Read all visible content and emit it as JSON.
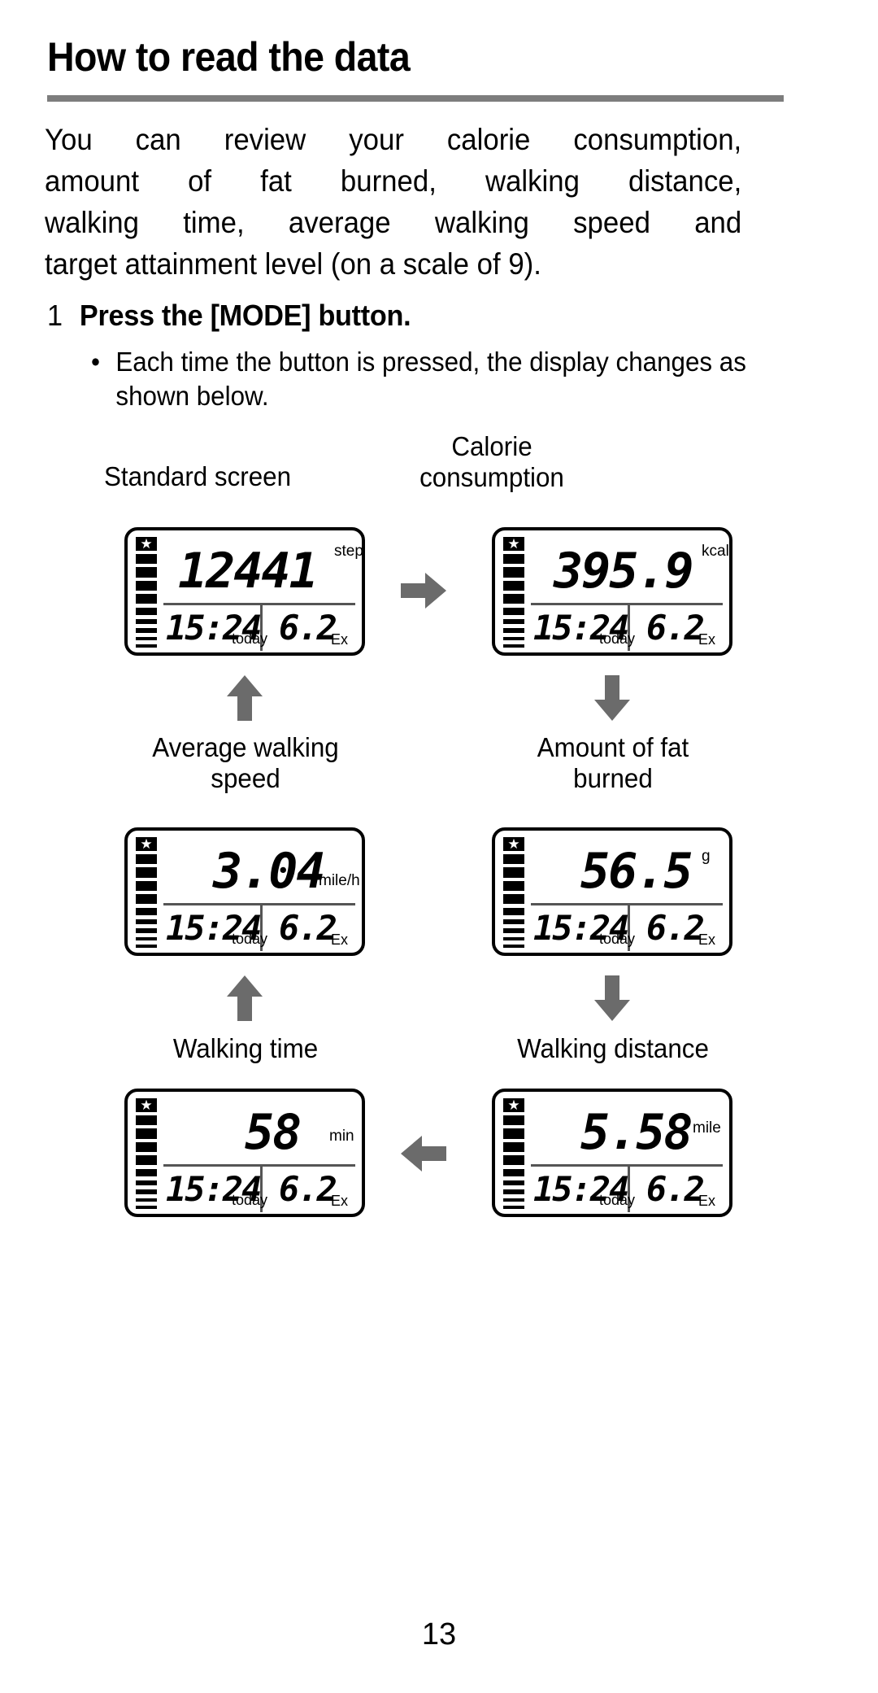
{
  "page": {
    "title": "How to read the data",
    "page_number": "13",
    "rule_color": "#7d7d7d",
    "arrow_color": "#6b6b6b"
  },
  "intro": {
    "line1": "You can review your calorie consumption,",
    "line2": "amount of fat burned, walking distance,",
    "line3": "walking time, average walking speed and",
    "line4": "target attainment level (on a scale of 9)."
  },
  "step": {
    "number": "1",
    "text": "Press the [MODE] button."
  },
  "bullet": {
    "marker": "•",
    "text": "Each time the button is pressed, the display changes as shown below."
  },
  "captions": {
    "standard": "Standard screen",
    "calorie": "Calorie\nconsumption",
    "calorie_l1": "Calorie",
    "calorie_l2": "consumption",
    "avg_speed_l1": "Average walking",
    "avg_speed_l2": "speed",
    "fat_l1": "Amount of fat",
    "fat_l2": "burned",
    "walking_time": "Walking time",
    "walking_distance": "Walking distance"
  },
  "screens": [
    {
      "id": "standard-screen",
      "main_value": "12441",
      "main_unit": "step",
      "time_value": "15:24",
      "time_label": "today",
      "ex_value": "6.2",
      "ex_label": "Ex",
      "star": "★",
      "filled_squares": 4,
      "thin_bars": 5
    },
    {
      "id": "calorie-consumption-screen",
      "main_value": "395.9",
      "main_unit": "kcal",
      "time_value": "15:24",
      "time_label": "today",
      "ex_value": "6.2",
      "ex_label": "Ex",
      "star": "★",
      "filled_squares": 4,
      "thin_bars": 5
    },
    {
      "id": "average-walking-speed-screen",
      "main_value": "3.04",
      "main_unit": "mile/h",
      "time_value": "15:24",
      "time_label": "today",
      "ex_value": "6.2",
      "ex_label": "Ex",
      "star": "★",
      "filled_squares": 4,
      "thin_bars": 5
    },
    {
      "id": "amount-of-fat-burned-screen",
      "main_value": "56.5",
      "main_unit": "g",
      "time_value": "15:24",
      "time_label": "today",
      "ex_value": "6.2",
      "ex_label": "Ex",
      "star": "★",
      "filled_squares": 4,
      "thin_bars": 5
    },
    {
      "id": "walking-time-screen",
      "main_value": "58",
      "main_unit": "min",
      "time_value": "15:24",
      "time_label": "today",
      "ex_value": "6.2",
      "ex_label": "Ex",
      "star": "★",
      "filled_squares": 4,
      "thin_bars": 5
    },
    {
      "id": "walking-distance-screen",
      "main_value": "5.58",
      "main_unit": "mile",
      "time_value": "15:24",
      "time_label": "today",
      "ex_value": "6.2",
      "ex_label": "Ex",
      "star": "★",
      "filled_squares": 4,
      "thin_bars": 5
    }
  ],
  "flow_arrows": [
    {
      "id": "arrow-standard-to-calorie",
      "direction": "right"
    },
    {
      "id": "arrow-calorie-to-fat",
      "direction": "down"
    },
    {
      "id": "arrow-fat-to-distance",
      "direction": "down"
    },
    {
      "id": "arrow-distance-to-time",
      "direction": "left"
    },
    {
      "id": "arrow-time-to-speed",
      "direction": "up"
    },
    {
      "id": "arrow-speed-to-standard",
      "direction": "up"
    }
  ]
}
